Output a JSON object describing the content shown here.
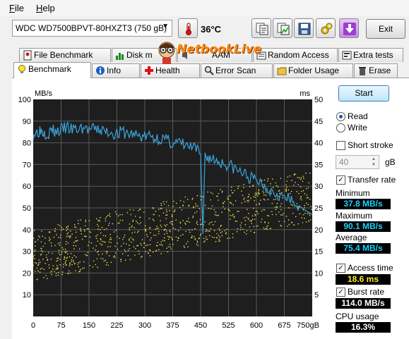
{
  "menu": {
    "file": "F",
    "file_rest": "ile",
    "help": "H",
    "help_rest": "elp"
  },
  "toolbar": {
    "drive": "WDC WD7500BPVT-80HXZT3 (750 gB)",
    "temperature": "36°C",
    "exit_label": "Exit",
    "icons": [
      "copy-text-icon",
      "copy-image-icon",
      "save-icon",
      "options-icon",
      "download-icon"
    ]
  },
  "tabs_top": [
    "File Benchmark",
    "Disk m",
    "AAM",
    "Random Access",
    "Extra tests"
  ],
  "tabs_bottom": [
    "Benchmark",
    "Info",
    "Health",
    "Error Scan",
    "Folder Usage",
    "Erase"
  ],
  "watermark": "NetbookLive",
  "controls": {
    "start_label": "Start",
    "read_label": "Read",
    "write_label": "Write",
    "mode": "read",
    "short_stroke_label": "Short stroke",
    "short_stroke_checked": false,
    "short_stroke_value": "40",
    "short_stroke_unit": "gB",
    "transfer_rate_label": "Transfer rate",
    "transfer_rate_checked": true,
    "minimum_label": "Minimum",
    "minimum_value": "37.8 MB/s",
    "maximum_label": "Maximum",
    "maximum_value": "90.1 MB/s",
    "average_label": "Average",
    "average_value": "75.4 MB/s",
    "access_time_label": "Access time",
    "access_time_checked": true,
    "access_time_value": "18.6 ms",
    "burst_rate_label": "Burst rate",
    "burst_rate_checked": true,
    "burst_rate_value": "114.0 MB/s",
    "cpu_usage_label": "CPU usage",
    "cpu_usage_value": "16.3%"
  },
  "chart_data": {
    "type": "line",
    "ylabel": "MB/s",
    "y2label": "ms",
    "xlim": [
      0,
      750
    ],
    "ylim": [
      0,
      100
    ],
    "y2lim": [
      0,
      50
    ],
    "x_ticks": [
      "0",
      "75",
      "150",
      "225",
      "300",
      "375",
      "450",
      "525",
      "600",
      "675",
      "750gB"
    ],
    "y_ticks": [
      "10",
      "20",
      "30",
      "40",
      "50",
      "60",
      "70",
      "80",
      "90",
      "100"
    ],
    "y2_ticks": [
      "5",
      "10",
      "15",
      "20",
      "25",
      "30",
      "35",
      "40",
      "45",
      "50"
    ],
    "grid": true,
    "colors": {
      "transfer": "#3aa4dc",
      "access": "#e6e64a",
      "background": "#1e1e1e",
      "grid": "#5a5a5a"
    },
    "series": [
      {
        "x": [
          0,
          10,
          20,
          30,
          40,
          50,
          60,
          75,
          90,
          105,
          120,
          135,
          150,
          165,
          180,
          195,
          210,
          225,
          240,
          255,
          270,
          285,
          300,
          315,
          330,
          345,
          360,
          375,
          390,
          405,
          420,
          435,
          450,
          456,
          462,
          475,
          490,
          505,
          520,
          535,
          550,
          565,
          580,
          595,
          610,
          625,
          640,
          655,
          670,
          685,
          700,
          715,
          730,
          740,
          750
        ],
        "y": [
          84,
          85,
          86,
          85,
          84,
          86,
          85,
          86,
          87,
          86,
          86,
          87,
          86,
          86,
          86,
          85,
          85,
          84,
          85,
          84,
          84,
          83,
          83,
          83,
          82,
          82,
          81,
          80,
          80,
          79,
          78,
          77,
          75,
          38,
          74,
          73,
          72,
          71,
          70,
          69,
          67,
          66,
          64,
          63,
          62,
          60,
          58,
          57,
          55,
          54,
          52,
          51,
          49,
          48,
          47
        ]
      }
    ],
    "access_time_ms": {
      "min": 5,
      "max": 33,
      "average": 18.6
    }
  }
}
